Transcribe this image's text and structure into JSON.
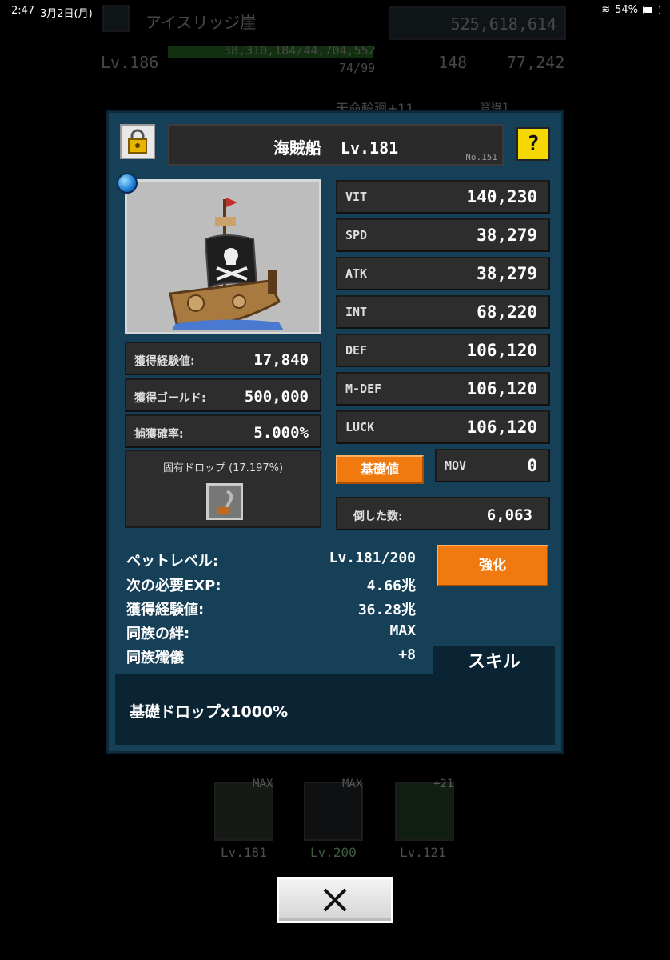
{
  "status_bar": {
    "time": "2:47",
    "date": "3月2日(月)",
    "battery": "54%"
  },
  "background_hud": {
    "location": "アイスリッジ崖",
    "gold": "525,618,614",
    "level": "Lv.186",
    "exp": "38,310,184/44,704,552",
    "sub_exp": "74/99",
    "gems": "148",
    "coins": "77,242",
    "tab1": "天命輪廻+11",
    "tab2": "習得1"
  },
  "dialog": {
    "title": "海賊船",
    "title_level": "Lv.181",
    "number": "No.151",
    "help_label": "?",
    "stats": [
      {
        "label": "VIT",
        "value": "140,230"
      },
      {
        "label": "SPD",
        "value": "38,279"
      },
      {
        "label": "ATK",
        "value": "38,279"
      },
      {
        "label": "INT",
        "value": "68,220"
      },
      {
        "label": "DEF",
        "value": "106,120"
      },
      {
        "label": "M-DEF",
        "value": "106,120"
      },
      {
        "label": "LUCK",
        "value": "106,120"
      }
    ],
    "base_value_button": "基礎値",
    "mov": {
      "label": "MOV",
      "value": "0"
    },
    "defeated": {
      "label": "倒した数:",
      "value": "6,063"
    },
    "rewards": [
      {
        "label": "獲得経験値:",
        "value": "17,840"
      },
      {
        "label": "獲得ゴールド:",
        "value": "500,000"
      },
      {
        "label": "捕獲確率:",
        "value": "5.000%"
      }
    ],
    "unique_drop": "固有ドロップ (17.197%)",
    "info": [
      {
        "label": "ペットレベル:",
        "value": "Lv.181/200"
      },
      {
        "label": "次の必要EXP:",
        "value": "4.66兆"
      },
      {
        "label": "獲得経験値:",
        "value": "36.28兆"
      },
      {
        "label": "同族の絆:",
        "value": "MAX"
      },
      {
        "label": "同族殲儀",
        "value": "+8"
      }
    ],
    "enhance_button": "強化",
    "skill_header": "スキル",
    "skill_text": "基礎ドロップx1000%"
  },
  "pets_row": [
    {
      "level": "Lv.181",
      "badge": "MAX"
    },
    {
      "level": "Lv.200",
      "badge": "MAX"
    },
    {
      "level": "Lv.121",
      "badge": "+21"
    }
  ],
  "colors": {
    "dialog_bg": "#164058",
    "accent_orange": "#f07a0f",
    "help_yellow": "#f5d800"
  }
}
